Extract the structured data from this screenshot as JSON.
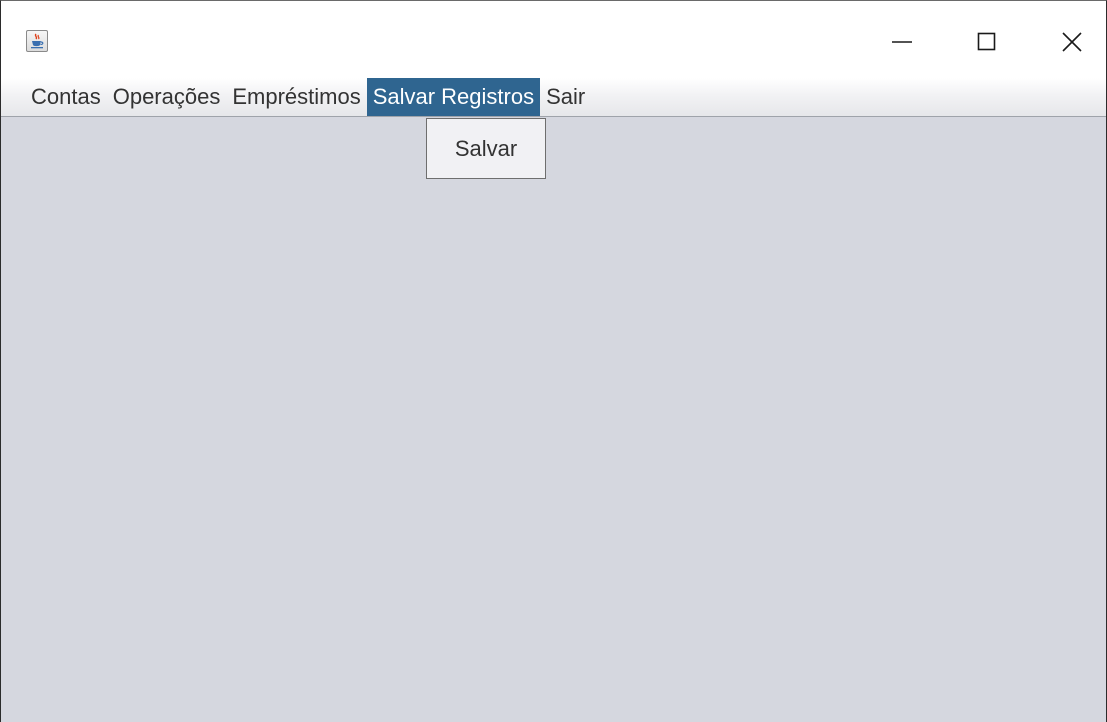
{
  "window": {
    "icon": "java-coffee-cup-icon",
    "controls": {
      "minimize_icon": "minimize-icon",
      "maximize_icon": "maximize-icon",
      "close_icon": "close-icon"
    }
  },
  "menubar": {
    "items": [
      {
        "label": "Contas",
        "active": false
      },
      {
        "label": "Operações",
        "active": false
      },
      {
        "label": "Empréstimos",
        "active": false
      },
      {
        "label": "Salvar Registros",
        "active": true
      },
      {
        "label": "Sair",
        "active": false
      }
    ]
  },
  "dropdown": {
    "parent": "Salvar Registros",
    "items": [
      {
        "label": "Salvar"
      }
    ]
  },
  "colors": {
    "menu_selected_bg": "#2f6590",
    "content_bg": "#d5d7df",
    "dropdown_bg": "#f1f1f4"
  }
}
